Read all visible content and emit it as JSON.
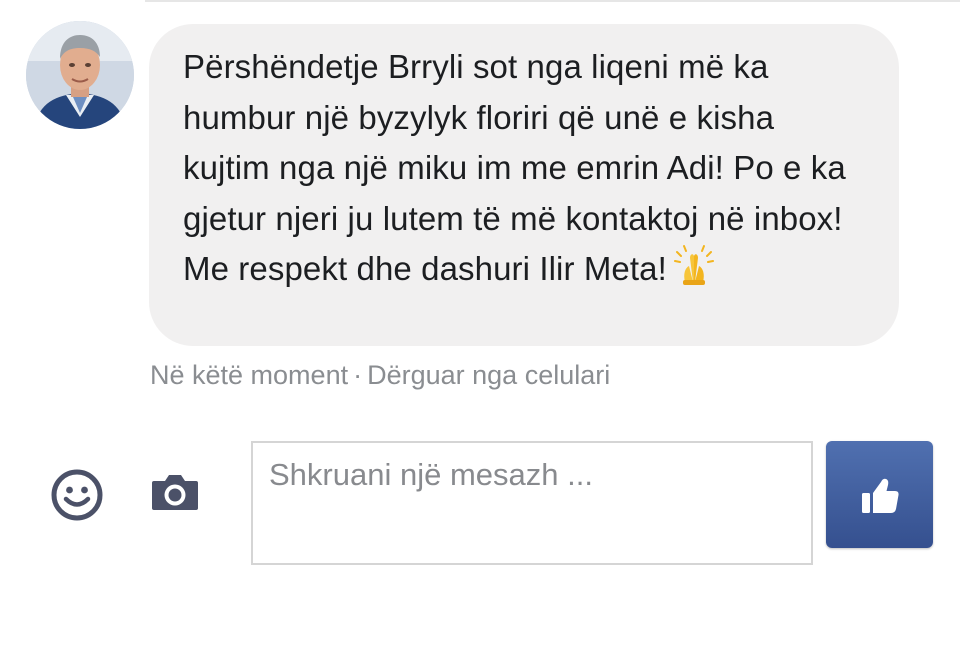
{
  "message": {
    "text": "Përshëndetje Brryli sot nga liqeni më ka humbur një byzylyk floriri që unë e kisha kujtim nga një miku im me emrin Adi! Po e ka gjetur njeri ju lutem të më kontaktoj në inbox! Me respekt dhe dashuri Ilir Meta!",
    "emoji": "folded-hands-icon",
    "bubble_color": "#f1f0f0",
    "text_color": "#1c1e21"
  },
  "meta": {
    "time": "Në këtë moment",
    "separator": "·",
    "sent_via": "Dërguar nga celulari",
    "color": "#8a8d91"
  },
  "composer": {
    "emoji_icon": "smiley-icon",
    "camera_icon": "camera-icon",
    "placeholder": "Shkruani një mesazh ...",
    "value": "",
    "like_icon": "thumbs-up-icon",
    "accent_color": "#3b5998",
    "icon_color": "#4b5168"
  }
}
